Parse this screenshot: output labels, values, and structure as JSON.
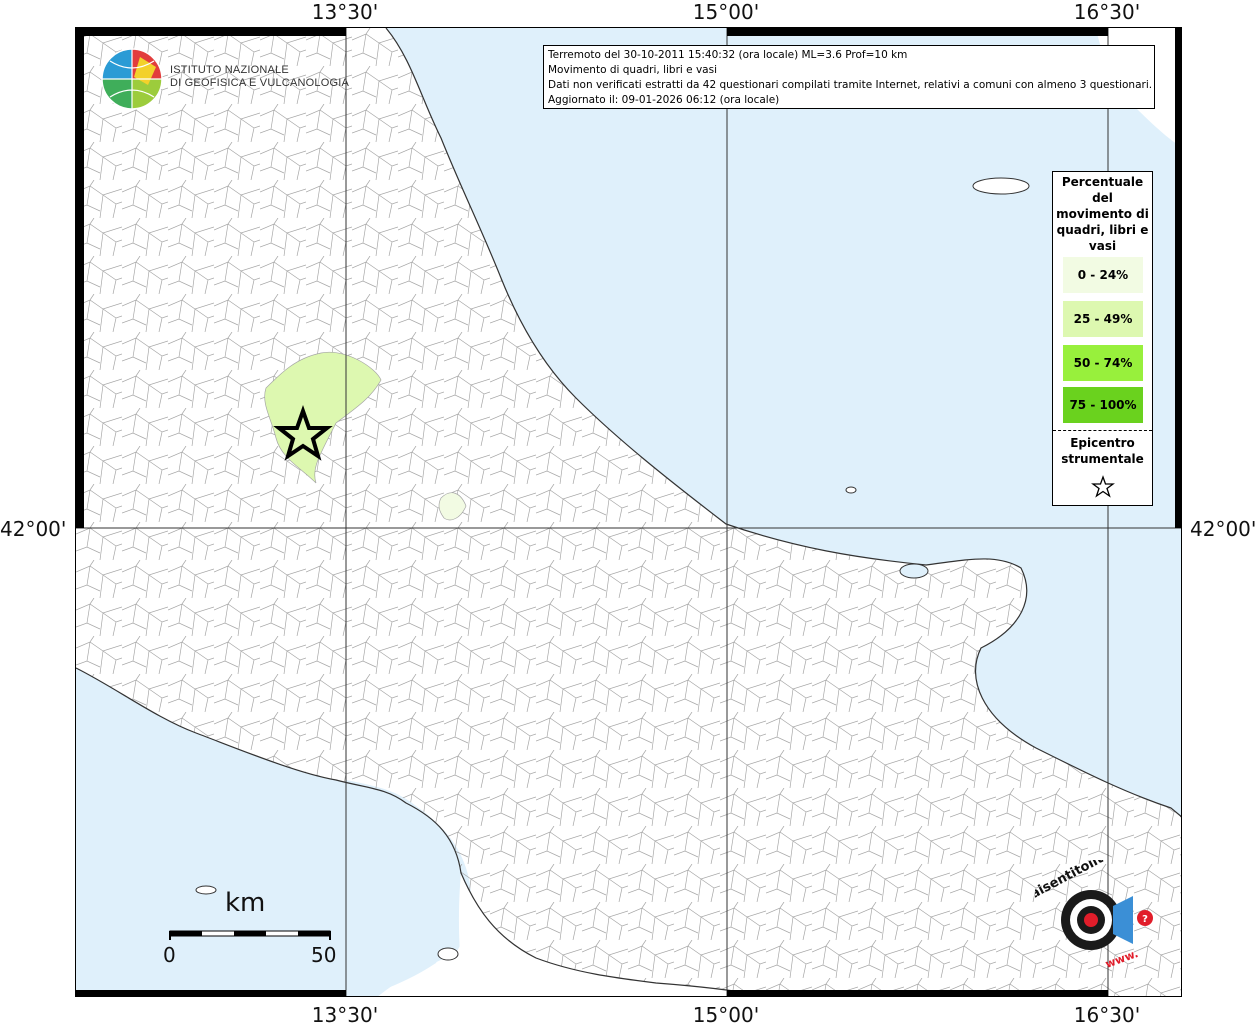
{
  "map": {
    "coordinates": {
      "top": [
        "13°30'",
        "15°00'",
        "16°30'"
      ],
      "bottom": [
        "13°30'",
        "15°00'",
        "16°30'"
      ],
      "left": "42°00'",
      "right": "42°00'"
    },
    "colors": {
      "sea": "#dff0fb",
      "land": "#ffffff",
      "borders": "#9a9a9a",
      "grid": "#333333"
    }
  },
  "info": {
    "line1": "Terremoto del 30-10-2011 15:40:32 (ora locale) ML=3.6 Prof=10 km",
    "line2": "Movimento di quadri, libri e vasi",
    "line3": "Dati non verificati estratti da 42 questionari compilati tramite Internet, relativi a comuni con almeno 3 questionari.",
    "line4": "Aggiornato il: 09-01-2026 06:12 (ora locale)"
  },
  "legend": {
    "title": "Percentuale del movimento di quadri, libri e vasi",
    "items": [
      {
        "label": "0 - 24%",
        "color": "#f2fbe3"
      },
      {
        "label": "25 - 49%",
        "color": "#ddf8b0"
      },
      {
        "label": "50 - 74%",
        "color": "#98f03c"
      },
      {
        "label": "75 - 100%",
        "color": "#6ad21e"
      }
    ],
    "epicenter_label": "Epicentro strumentale",
    "epicenter_icon": "star-icon"
  },
  "institute": {
    "line1": "ISTITUTO NAZIONALE",
    "line2": "DI GEOFISICA E VULCANOLOGIA"
  },
  "scalebar": {
    "unit": "km",
    "start": "0",
    "end": "50"
  },
  "site_logo": {
    "text": "haisentitoilterremoto.it",
    "www": "www."
  }
}
